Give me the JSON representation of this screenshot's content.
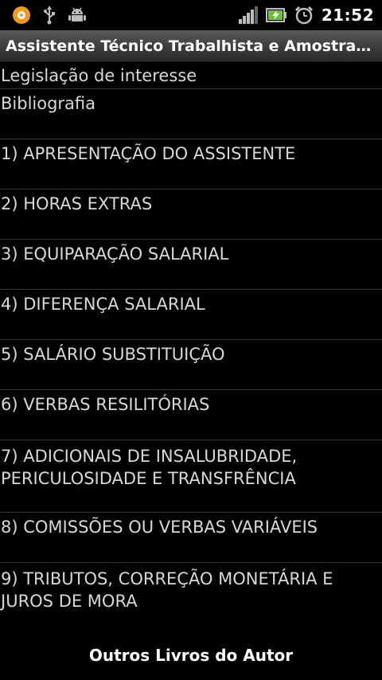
{
  "status_bar": {
    "icons": [
      "notification-ring-icon",
      "usb-icon",
      "android-debug-icon",
      "signal-icon",
      "battery-icon",
      "alarm-clock-icon"
    ],
    "time": "21:52",
    "accent_color": "#f39a1e"
  },
  "title_bar": {
    "title": "Assistente Técnico Trabalhista e Amostras d..."
  },
  "list": {
    "items": [
      {
        "label": "Legislação de interesse"
      },
      {
        "label": "Bibliografia"
      },
      {
        "label": "1) APRESENTAÇÃO DO ASSISTENTE"
      },
      {
        "label": "2) HORAS EXTRAS"
      },
      {
        "label": "3) EQUIPARAÇÃO SALARIAL"
      },
      {
        "label": "4) DIFERENÇA SALARIAL"
      },
      {
        "label": "5) SALÁRIO SUBSTITUIÇÃO"
      },
      {
        "label": "6) VERBAS RESILITÓRIAS"
      },
      {
        "label": "7) ADICIONAIS DE INSALUBRIDADE, PERICULOSIDADE E TRANSFRÊNCIA"
      },
      {
        "label": "8) COMISSÕES OU VERBAS VARIÁVEIS"
      },
      {
        "label": "9) TRIBUTOS, CORREÇÃO MONETÁRIA E JUROS DE MORA"
      }
    ]
  },
  "footer": {
    "label": "Outros Livros do Autor"
  }
}
